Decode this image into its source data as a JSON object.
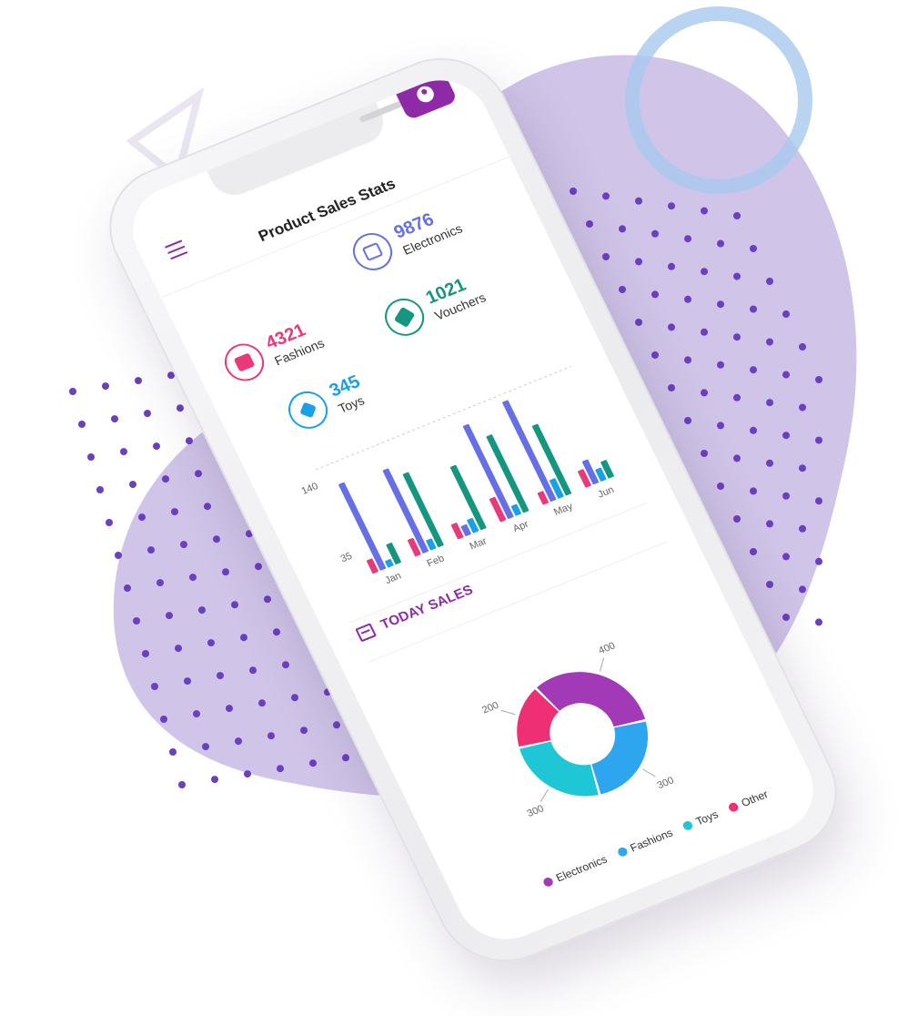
{
  "app": {
    "title": "Product Sales Stats"
  },
  "stats": [
    {
      "value": "4321",
      "label": "Fashions",
      "color": "#e83a7a",
      "icon": "book-reader-icon"
    },
    {
      "value": "9876",
      "label": "Electronics",
      "color": "#6570e6",
      "icon": "laptop-icon"
    },
    {
      "value": "1021",
      "label": "Vouchers",
      "color": "#14967f",
      "icon": "ticket-icon"
    },
    {
      "value": "345",
      "label": "Toys",
      "color": "#1aa0e6",
      "icon": "pinwheel-icon"
    }
  ],
  "colors": {
    "accent": "#8e2aa8",
    "blob": "#d0c4e8",
    "dots": "#6a3fc1"
  },
  "chart_data": [
    {
      "type": "bar",
      "categories": [
        "Jan",
        "Feb",
        "Mar",
        "Apr",
        "May",
        "Jun"
      ],
      "yticks": [
        "35",
        "140"
      ],
      "series": [
        {
          "values": [
            20,
            25,
            22,
            35,
            18,
            25
          ],
          "color": "#e83a7a"
        },
        {
          "values": [
            130,
            125,
            15,
            140,
            150,
            35
          ],
          "color": "#6570e6"
        },
        {
          "values": [
            10,
            15,
            20,
            15,
            28,
            18
          ],
          "color": "#1aa0e6"
        },
        {
          "values": [
            30,
            110,
            95,
            115,
            105,
            25
          ],
          "color": "#14967f"
        }
      ]
    },
    {
      "type": "pie",
      "title": "TODAY SALES",
      "categories": [
        "Electronics",
        "Fashions",
        "Toys",
        "Other"
      ],
      "values": [
        400,
        300,
        300,
        200
      ],
      "value_labels": [
        "400",
        "300",
        "300",
        "200"
      ],
      "colors": [
        "#a23ab8",
        "#2ea6ef",
        "#1fc6d6",
        "#ee2f74"
      ],
      "hole": 0.5,
      "legend": "bottom"
    }
  ]
}
